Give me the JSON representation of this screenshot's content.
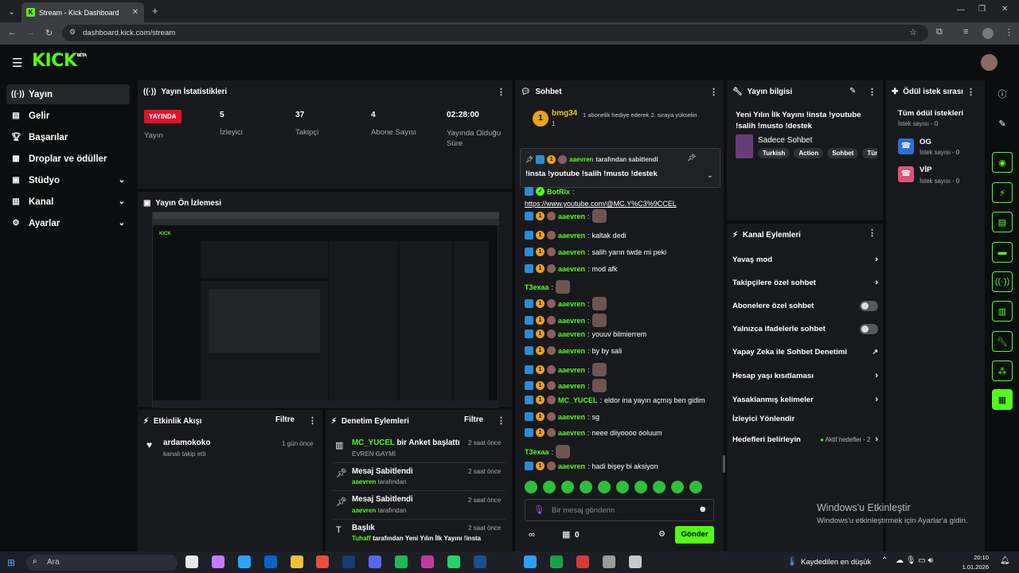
{
  "browser": {
    "tab_title": "Stream - Kick Dashboard",
    "url": "dashboard.kick.com/stream"
  },
  "logo": "KICK",
  "logo_beta": "BETA",
  "sidebar": {
    "items": [
      {
        "label": "Yayın",
        "icon": "broadcast-icon"
      },
      {
        "label": "Gelir",
        "icon": "revenue-icon"
      },
      {
        "label": "Başarılar",
        "icon": "trophy-icon"
      },
      {
        "label": "Droplar ve ödüller",
        "icon": "drops-icon"
      },
      {
        "label": "Stüdyo",
        "icon": "studio-icon"
      },
      {
        "label": "Kanal",
        "icon": "channel-icon"
      },
      {
        "label": "Ayarlar",
        "icon": "settings-icon"
      }
    ]
  },
  "stats": {
    "title": "Yayın İstatistikleri",
    "live_badge": "YAYINDA",
    "live_label": "Yayın",
    "items": [
      {
        "value": "5",
        "label": "İzleyici"
      },
      {
        "value": "37",
        "label": "Takipçi"
      },
      {
        "value": "4",
        "label": "Abone Sayısı"
      },
      {
        "value": "02:28:00",
        "label": "Yayında Olduğu Süre"
      }
    ]
  },
  "preview": {
    "title": "Yayın Ön İzlemesi"
  },
  "activity": {
    "title": "Etkinlik Akışı",
    "filter": "Filtre",
    "items": [
      {
        "name": "ardamokoko",
        "desc": "kanalı takip etti",
        "time": "1 gün önce"
      }
    ]
  },
  "moderation": {
    "title": "Denetim Eylemleri",
    "filter": "Filtre",
    "items": [
      {
        "title_user": "MC_YUCEL",
        "title": " bir Anket başlattı",
        "sub": "EVREN GAYMİ",
        "sub_user": "",
        "time": "2 saat önce"
      },
      {
        "title_user": "",
        "title": "Mesaj Sabitlendi",
        "sub": "tarafından",
        "sub_user": "aaevren",
        "time": "2 saat önce"
      },
      {
        "title_user": "",
        "title": "Mesaj Sabitlendi",
        "sub": "tarafından",
        "sub_user": "aaevren",
        "time": "2 saat önce"
      },
      {
        "title_user": "",
        "title": "Başlık",
        "sub": "tarafından Yeni Yılın İlk Yayını !insta",
        "sub_user": "Tuhaff",
        "time": "2 saat önce"
      }
    ]
  },
  "chat": {
    "title": "Sohbet",
    "top_user": "bmg34",
    "top_count": "1",
    "top_note": "1 abonelik hediye ederek 2. sıraya yükselin",
    "pinned_by": "aaevren",
    "pinned_by_suffix": "tarafından sabitlendi",
    "pinned_text": "!insta !youtube !salih !musto !destek",
    "messages": [
      {
        "user": "BotRix",
        "text": "",
        "link": "https://www.youtube.com/@MC.Y%C3%9CCEL",
        "emote": false
      },
      {
        "user": "aaevren",
        "text": "",
        "emote": true
      },
      {
        "user": "aaevren",
        "text": "kaltak dedi",
        "emote": false
      },
      {
        "user": "aaevren",
        "text": "salih yarın twde mi peki",
        "emote": false
      },
      {
        "user": "aaevren",
        "text": "mod afk",
        "emote": false
      },
      {
        "user": "T3exaa",
        "text": "",
        "emote": true,
        "plain": true
      },
      {
        "user": "aaevren",
        "text": "",
        "emote": true
      },
      {
        "user": "aaevren",
        "text": "",
        "emote": true
      },
      {
        "user": "aaevren",
        "text": "youuv bilmierrem",
        "emote": false
      },
      {
        "user": "aaevren",
        "text": "by by sali",
        "emote": false
      },
      {
        "user": "aaevren",
        "text": "",
        "emote": true
      },
      {
        "user": "aaevren",
        "text": "",
        "emote": true
      },
      {
        "user": "MC_YUCEL",
        "text": "eldor ina yayın açmış ben gidim",
        "emote": false
      },
      {
        "user": "aaevren",
        "text": "sg",
        "emote": false
      },
      {
        "user": "aaevren",
        "text": "neee diiyoooo ooluum",
        "emote": false
      },
      {
        "user": "T3exaa",
        "text": "",
        "emote": true,
        "plain": true
      },
      {
        "user": "aaevren",
        "text": "hadi bişey bi aksiyon",
        "emote": false
      }
    ],
    "input_placeholder": "Bir mesaj gönderin",
    "points": "0",
    "send": "Gönder"
  },
  "streaminfo": {
    "title": "Yayın bilgisi",
    "stream_title": "Yeni Yılın İlk Yayını !insta !youtube !salih !musto !destek",
    "category": "Sadece Sohbet",
    "tags": [
      "Turkish",
      "Action",
      "Sohbet",
      "Tür"
    ]
  },
  "channel_actions": {
    "title": "Kanal Eylemleri",
    "items": [
      {
        "label": "Yavaş mod",
        "type": "arrow"
      },
      {
        "label": "Takipçilere özel sohbet",
        "type": "arrow"
      },
      {
        "label": "Abonelere özel sohbet",
        "type": "toggle"
      },
      {
        "label": "Yalnızca ifadelerle sohbet",
        "type": "toggle"
      },
      {
        "label": "Yapay Zeka ile Sohbet Denetimi",
        "type": "ext"
      },
      {
        "label": "Hesap yaşı kısıtlaması",
        "type": "arrow"
      },
      {
        "label": "Yasaklanmış kelimeler",
        "type": "arrow"
      },
      {
        "label": "İzleyici Yönlendir",
        "type": "none"
      },
      {
        "label": "Hedefleri belirleyin",
        "type": "arrow",
        "extra": "Aktif hedefler - 2"
      }
    ]
  },
  "rewards": {
    "title": "Ödül istek sırası",
    "all": "Tüm ödül istekleri",
    "all_count": "İstek sayısı - 0",
    "items": [
      {
        "name": "OG",
        "count": "İstek sayısı - 0",
        "color": "#2b6fd6"
      },
      {
        "name": "VİP",
        "count": "İstek sayısı - 0",
        "color": "#e0527e"
      }
    ]
  },
  "watermark": {
    "line1": "Windows'u Etkinleştir",
    "line2": "Windows'u etkinleştirmek için Ayarlar'a gidin."
  },
  "taskbar": {
    "search": "Ara",
    "weather": "Kaydedilen en düşük",
    "time": "20:10",
    "date": "1.01.2026"
  },
  "colors": {
    "accent": "#53fc18",
    "panel": "#18191c",
    "bg": "#0b0e0f"
  }
}
